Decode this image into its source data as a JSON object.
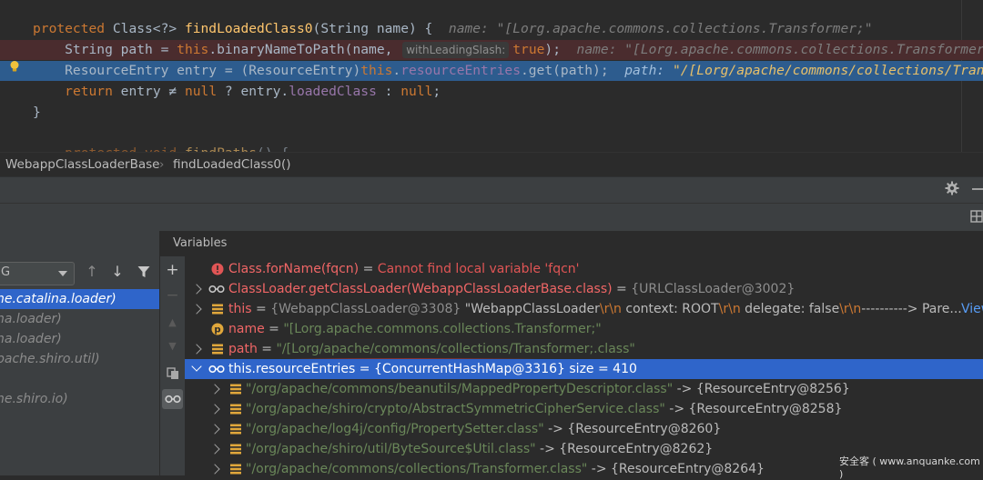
{
  "editor": {
    "lines": [
      {
        "parts": [
          [
            "kw",
            "protected "
          ],
          [
            "pl",
            "Class<?> "
          ],
          [
            "fn",
            "findLoadedClass0"
          ],
          [
            "pl",
            "(String name) {"
          ]
        ],
        "inline": "  name: \"[Lorg.apache.commons.collections.Transformer;\""
      },
      {
        "parts": [
          [
            "pl",
            "    String path = "
          ],
          [
            "kw",
            "this"
          ],
          [
            "pl",
            ".binaryNameToPath(name, "
          ]
        ],
        "hint": "withLeadingSlash:",
        "parts2": [
          [
            "kw",
            "true"
          ],
          [
            "pl",
            ");"
          ]
        ],
        "inline": "  name: \"[Lorg.apache.commons.collections.Transformer;\""
      },
      {
        "parts": [
          [
            "pl",
            "    ResourceEntry entry = (ResourceEntry)"
          ],
          [
            "kw",
            "this"
          ],
          [
            "pl",
            "."
          ],
          [
            "fld",
            "resourceEntries"
          ],
          [
            "pl",
            ".get(path);"
          ]
        ],
        "inline_key": "  path: ",
        "inline_val": "\"/[Lorg/apache/commons/collections/Transformer;.class\""
      },
      {
        "parts": [
          [
            "pl",
            "    "
          ],
          [
            "kw",
            "return "
          ],
          [
            "pl",
            "entry ≠ "
          ],
          [
            "kw",
            "null"
          ],
          [
            "pl",
            " ? entry."
          ],
          [
            "fld",
            "loadedClass"
          ],
          [
            "pl",
            " : "
          ],
          [
            "kw",
            "null"
          ],
          [
            "pl",
            ";"
          ]
        ]
      },
      {
        "parts": [
          [
            "pl",
            "}"
          ]
        ]
      },
      {
        "parts": [
          [
            "pl",
            ""
          ]
        ]
      },
      {
        "parts": [
          [
            "kw",
            "    protected "
          ],
          [
            "kw",
            "void "
          ],
          [
            "fn",
            "findPaths"
          ],
          [
            "pl",
            "() {"
          ]
        ]
      }
    ]
  },
  "breadcrumb": {
    "class_name": "WebappClassLoaderBase",
    "method": "findLoadedClass0()"
  },
  "frames": {
    "filter_value": "G",
    "items": [
      {
        "label": "he.catalina.loader)",
        "selected": true
      },
      {
        "label": "na.loader)",
        "selected": false
      },
      {
        "label": "na.loader)",
        "selected": false
      },
      {
        "label": "pache.shiro.util)",
        "selected": false
      },
      {
        "label": "",
        "selected": false
      },
      {
        "label": "he.shiro.io)",
        "selected": false
      }
    ]
  },
  "variables": {
    "title": "Variables",
    "rows": [
      {
        "kind": "error",
        "name": "Class.forName(fqcn)",
        "eq": " = ",
        "value": "Cannot find local variable 'fqcn'"
      },
      {
        "kind": "watch",
        "name": "ClassLoader.getClassLoader(WebappClassLoaderBase.class)",
        "eq": " = ",
        "value": "{URLClassLoader@3002}"
      },
      {
        "kind": "field",
        "name": "this",
        "eq": " = ",
        "ref": "{WebappClassLoader@3308} ",
        "v1": "\"WebappClassLoader",
        "e1": "\\r\\n",
        "v2": "  context: ROOT",
        "e2": "\\r\\n",
        "v3": "  delegate: false",
        "e3": "\\r\\n",
        "v4": "----------> Pare...",
        "link": "View"
      },
      {
        "kind": "param",
        "name": "name",
        "eq": " = ",
        "value": "\"[Lorg.apache.commons.collections.Transformer;\""
      },
      {
        "kind": "field",
        "name": "path",
        "eq": " = ",
        "value": "\"/[Lorg/apache/commons/collections/Transformer;.class\""
      },
      {
        "kind": "watch-open",
        "name": "this.resourceEntries",
        "eq": " = ",
        "value": "{ConcurrentHashMap@3316}  size = 410"
      },
      {
        "kind": "entry",
        "key": "\"/org/apache/commons/beanutils/MappedPropertyDescriptor.class\"",
        "arrow": " -> ",
        "value": "{ResourceEntry@8256}"
      },
      {
        "kind": "entry",
        "key": "\"/org/apache/shiro/crypto/AbstractSymmetricCipherService.class\"",
        "arrow": " -> ",
        "value": "{ResourceEntry@8258}"
      },
      {
        "kind": "entry",
        "key": "\"/org/apache/log4j/config/PropertySetter.class\"",
        "arrow": " -> ",
        "value": "{ResourceEntry@8260}"
      },
      {
        "kind": "entry",
        "key": "\"/org/apache/shiro/util/ByteSource$Util.class\"",
        "arrow": " -> ",
        "value": "{ResourceEntry@8262}"
      },
      {
        "kind": "entry",
        "key": "\"/org/apache/commons/collections/Transformer.class\"",
        "arrow": " -> ",
        "value": "{ResourceEntry@8264}"
      }
    ]
  },
  "watermark": "安全客 ( www.anquanke.com )",
  "colors": {
    "selection": "#2f65ca",
    "editor_bg": "#2b2b2b",
    "panel_bg": "#3c3f41",
    "error_line": "#4a2c2e",
    "exec_line": "#2d5c8e"
  }
}
